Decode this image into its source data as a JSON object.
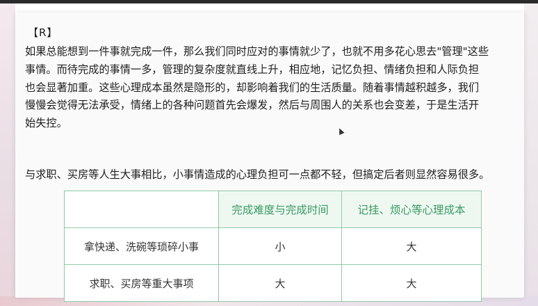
{
  "document": {
    "tag": "【R】",
    "paragraph_lines": [
      "如果总能想到一件事就完成一件，那么我们同时应对的事情就少了，也就不用多花心思去\"管理\"这些",
      "事情。而待完成的事情一多，管理的复杂度就直线上升，相应地，记忆负担、情绪负担和人际负担",
      "也会显著加重。这些心理成本虽然是隐形的，却影响着我们的生活质量。随着事情越积越多，我们",
      "慢慢会觉得无法承受，情绪上的各种问题首先会爆发，然后与周围人的关系也会变差，于是生活开",
      "始失控。"
    ],
    "lead_sentence": "与求职、买房等人生大事相比，小事情造成的心理负担可一点都不轻，但搞定后者则显然容易很多。"
  },
  "table": {
    "headers": [
      "",
      "完成难度与完成时间",
      "记挂、烦心等心理成本"
    ],
    "rows": [
      [
        "拿快递、洗碗等琐碎小事",
        "小",
        "大"
      ],
      [
        "求职、买房等重大事项",
        "大",
        "大"
      ]
    ]
  },
  "colors": {
    "table_border": "#8fc9a8",
    "header_text": "#3a9a63",
    "header_bg": "#eef8f1"
  }
}
